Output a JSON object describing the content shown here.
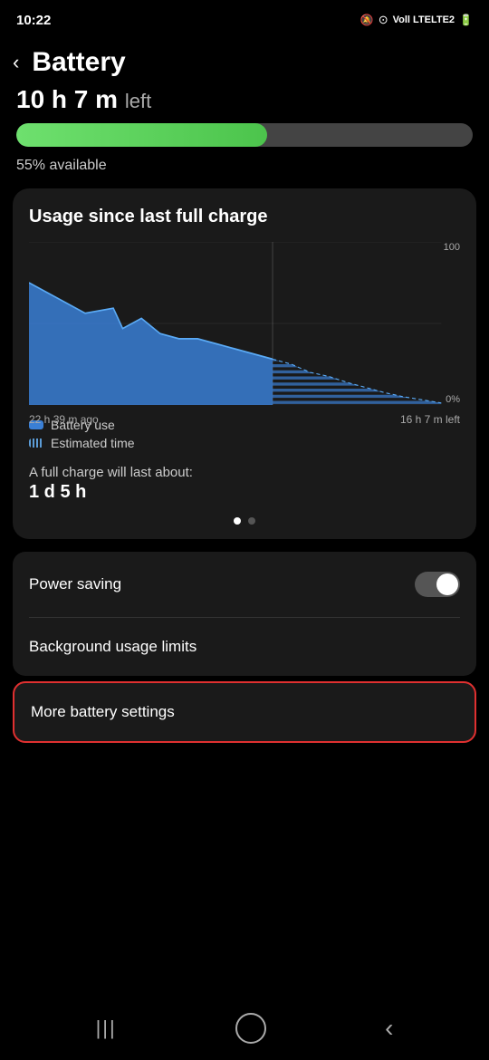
{
  "statusBar": {
    "time": "10:22",
    "icons": "🔕 ⊙ ᵛᵒˡᵗᵉ LTE2"
  },
  "header": {
    "backLabel": "‹",
    "title": "Battery"
  },
  "batteryTime": {
    "display": "10 h 7 m",
    "suffix": "left"
  },
  "batteryBar": {
    "percent": 55,
    "label": "55% available"
  },
  "usageCard": {
    "title": "Usage since last full charge",
    "chartLeftLabel": "22 h 39 m ago",
    "chartRightLabel": "16 h 7 m left",
    "chartY100": "100",
    "chartY0": "0%",
    "legend": [
      {
        "id": "battery-use",
        "label": "Battery use",
        "type": "solid"
      },
      {
        "id": "estimated-time",
        "label": "Estimated time",
        "type": "striped"
      }
    ],
    "fullCharge": {
      "label": "A full charge will last about:",
      "value": "1 d 5 h"
    }
  },
  "settings": {
    "powerSaving": {
      "label": "Power saving",
      "toggleOn": false
    },
    "backgroundUsage": {
      "label": "Background usage limits"
    },
    "moreBattery": {
      "label": "More battery settings"
    }
  },
  "bottomNav": {
    "recentIcon": "|||",
    "homeIcon": "○",
    "backIcon": "‹"
  }
}
